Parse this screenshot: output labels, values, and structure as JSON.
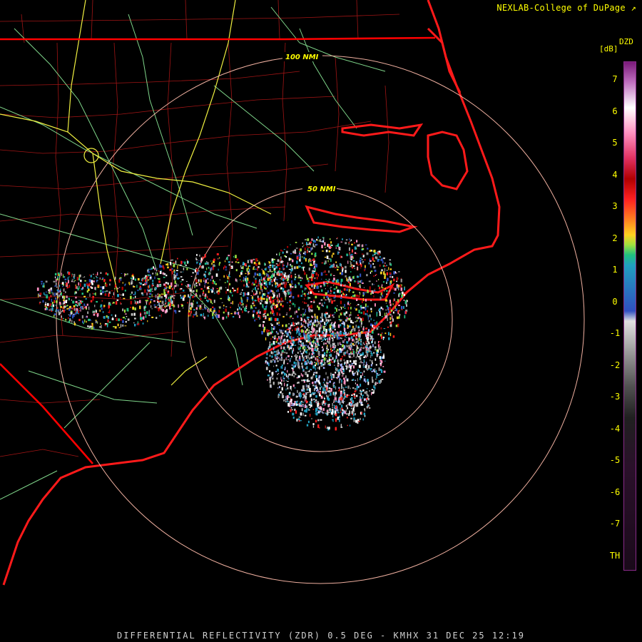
{
  "header": {
    "credit": "NEXLAB-College of DuPage"
  },
  "legend": {
    "product": "DZD",
    "unit": "[dB]",
    "ticks": [
      "7",
      "6",
      "5",
      "4",
      "3",
      "2",
      "1",
      "0",
      "-1",
      "-2",
      "-3",
      "-4",
      "-5",
      "-6",
      "-7",
      "TH"
    ]
  },
  "rings": {
    "inner_label": "50 NMI",
    "outer_label": "100 NMI"
  },
  "footer": {
    "title": "DIFFERENTIAL REFLECTIVITY (ZDR) 0.5 DEG - KMHX 31 DEC 25 12:19"
  },
  "colors": {
    "background": "#000000",
    "state_border": "#ff0000",
    "county_lines": "#b01818",
    "highways": "#f0f040",
    "roads": "#7fd68a",
    "ring": "#f0b0a0",
    "text": "#ffff00"
  }
}
